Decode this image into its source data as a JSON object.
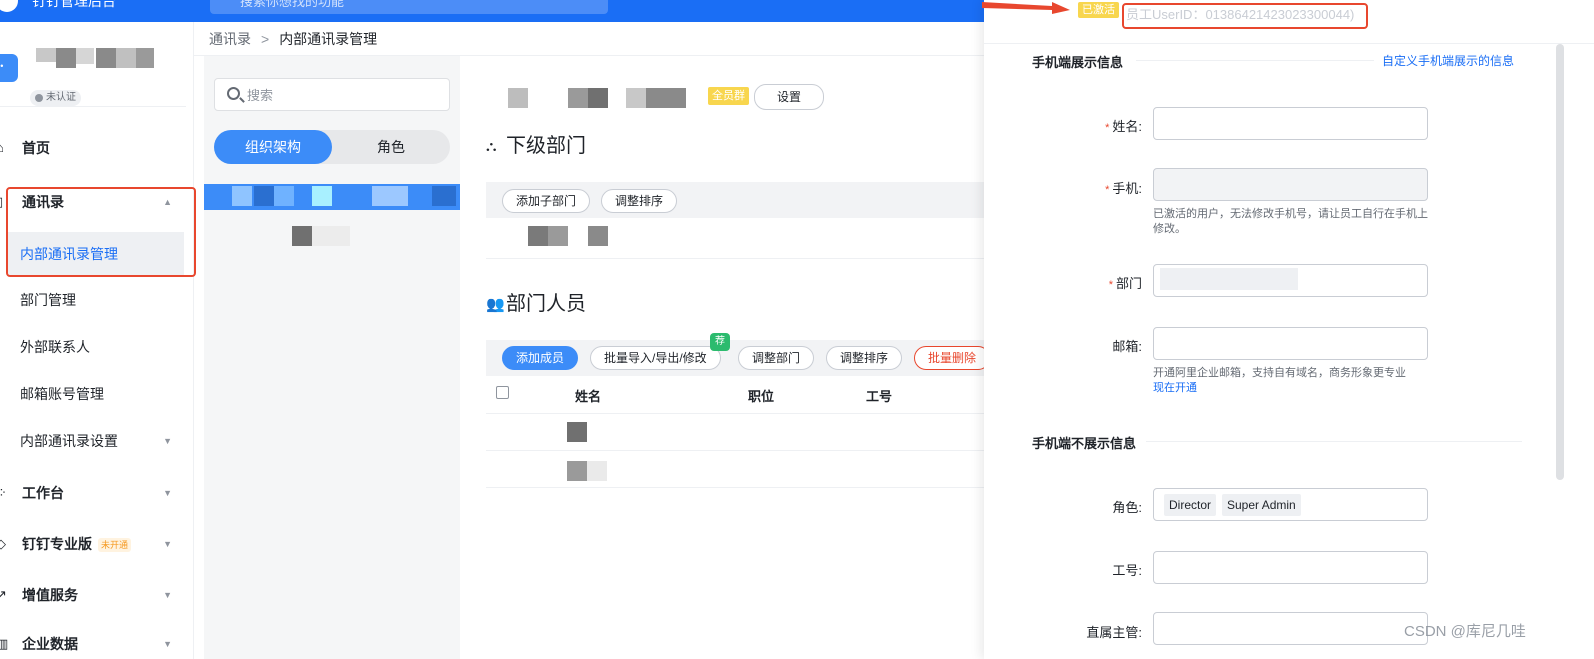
{
  "topbar": {
    "app_title": "钉钉管理后台",
    "search_placeholder": "搜索你想找的功能"
  },
  "sidebar": {
    "unverified_badge": "未认证",
    "items": [
      {
        "label": "首页",
        "icon": "home-icon"
      },
      {
        "label": "通讯录",
        "icon": "contacts-icon",
        "expanded": true
      },
      {
        "label": "内部通讯录管理",
        "active": true
      },
      {
        "label": "部门管理"
      },
      {
        "label": "外部联系人"
      },
      {
        "label": "邮箱账号管理"
      },
      {
        "label": "内部通讯录设置"
      },
      {
        "label": "工作台",
        "icon": "workbench-icon"
      },
      {
        "label": "钉钉专业版",
        "icon": "diamond-icon",
        "badge": "未开通"
      },
      {
        "label": "增值服务",
        "icon": "trend-icon"
      },
      {
        "label": "企业数据",
        "icon": "data-icon"
      }
    ]
  },
  "breadcrumb": {
    "parent": "通讯录",
    "separator": ">",
    "current": "内部通讯录管理"
  },
  "left_panel": {
    "search_placeholder": "搜索",
    "tabs": [
      {
        "label": "组织架构",
        "active": true
      },
      {
        "label": "角色",
        "active": false
      }
    ]
  },
  "main": {
    "group_tag": "全员群",
    "settings_button": "设置",
    "sub_departments": {
      "title": "下级部门",
      "buttons": {
        "add_sub": "添加子部门",
        "reorder": "调整排序"
      }
    },
    "members": {
      "title": "部门人员",
      "recommend_badge": "荐",
      "buttons": {
        "add_member": "添加成员",
        "batch": "批量导入/导出/修改",
        "adjust_dept": "调整部门",
        "reorder": "调整排序",
        "batch_delete": "批量删除"
      },
      "columns": [
        "姓名",
        "职位",
        "工号"
      ]
    }
  },
  "drawer": {
    "activated_tag": "已激活",
    "user_id": "员工UserID：013864214230233000​44)",
    "shown_section": "手机端展示信息",
    "custom_link": "自定义手机端展示的信息",
    "fields": {
      "name": {
        "label": "姓名:",
        "value": ""
      },
      "phone": {
        "label": "手机:",
        "value": "",
        "hint": "已激活的用户，无法修改手机号，请让员工自行在手机上修改。"
      },
      "dept": {
        "label": "部门",
        "value": ""
      },
      "email": {
        "label": "邮箱:",
        "value": "",
        "hint": "开通阿里企业邮箱，支持自有域名，商务形象更专业",
        "hint_link": "现在开通"
      }
    },
    "hidden_section": "手机端不展示信息",
    "hidden_fields": {
      "role": {
        "label": "角色:",
        "tags": [
          "Director",
          "Super Admin"
        ]
      },
      "job_no": {
        "label": "工号:",
        "value": ""
      },
      "supervisor": {
        "label": "直属主管:",
        "value": ""
      }
    }
  },
  "watermark": "CSDN @库尼几哇",
  "colors": {
    "primary": "#1a6ef5",
    "accent_blue": "#3c8cf8",
    "annotation_red": "#e8472e",
    "tag_yellow": "#f8d64e"
  }
}
